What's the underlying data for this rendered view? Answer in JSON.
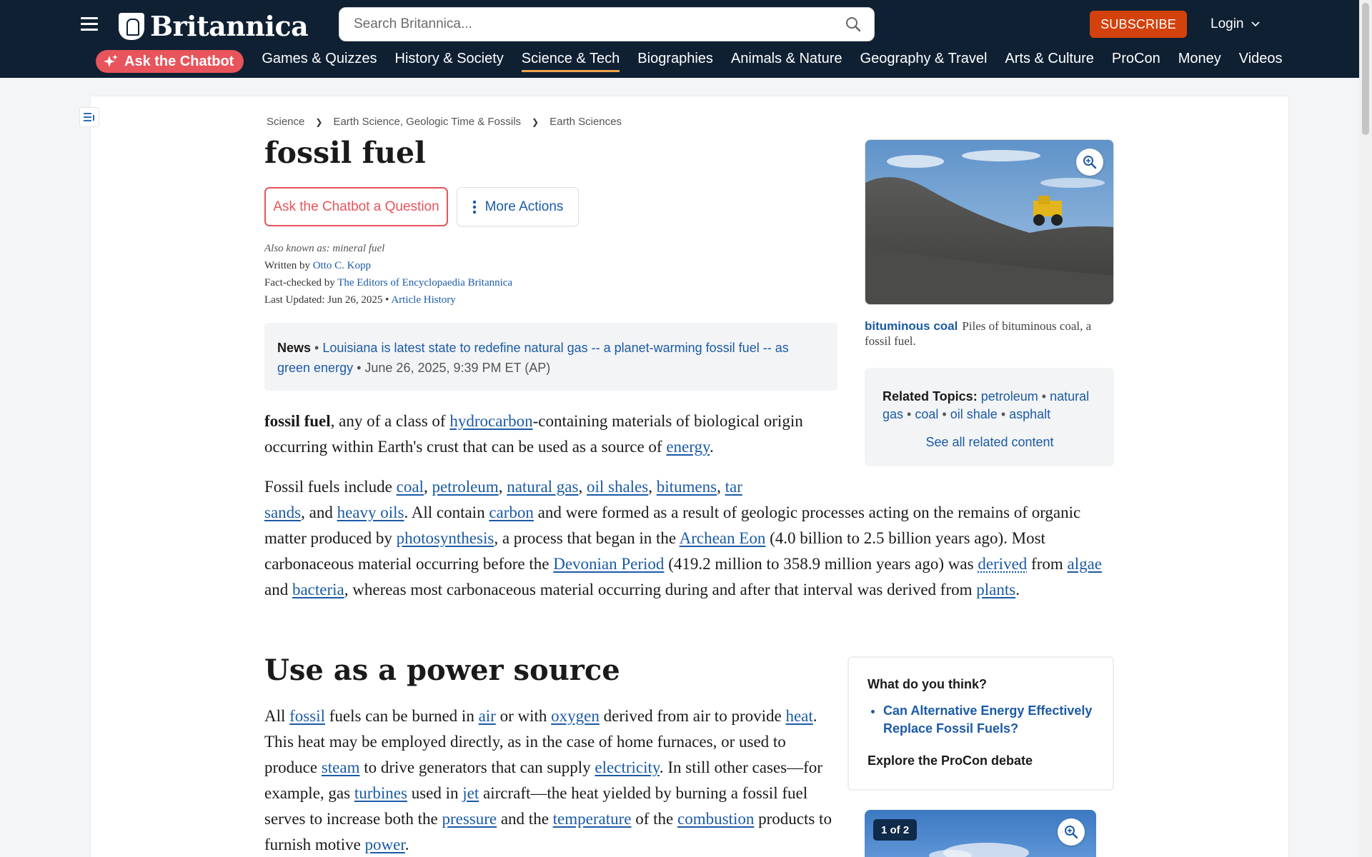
{
  "header": {
    "brand": "Britannica",
    "search_placeholder": "Search Britannica...",
    "subscribe_label": "SUBSCRIBE",
    "login_label": "Login"
  },
  "nav": {
    "chatbot_label": "Ask the Chatbot",
    "items": [
      "Games & Quizzes",
      "History & Society",
      "Science & Tech",
      "Biographies",
      "Animals & Nature",
      "Geography & Travel",
      "Arts & Culture",
      "ProCon",
      "Money",
      "Videos"
    ],
    "active": "Science & Tech"
  },
  "breadcrumb": [
    "Science",
    "Earth Science, Geologic Time & Fossils",
    "Earth Sciences"
  ],
  "article": {
    "title": "fossil fuel",
    "ask_chatbot_button": "Ask the Chatbot a Question",
    "more_actions_button": "More Actions",
    "also_known_as": "Also known as: mineral fuel",
    "written_by_label": "Written by",
    "author": "Otto C. Kopp",
    "fact_checked_label": "Fact-checked by",
    "fact_checker": "The Editors of Encyclopaedia Britannica",
    "last_updated_label": "Last Updated: Jun 26, 2025 •",
    "article_history": "Article History"
  },
  "news": {
    "label": "News",
    "bullet": "•",
    "headline": "Louisiana is latest state to redefine natural gas -- a planet-warming fossil fuel -- as green energy",
    "timestamp": "• June 26, 2025, 9:39 PM ET (AP)"
  },
  "paragraph1": {
    "term": "fossil fuel",
    "t1": ", any of a class of ",
    "l_hydrocarbon": "hydrocarbon",
    "t2": "-containing materials of biological origin occurring within Earth's crust that can be used as a source of ",
    "l_energy": "energy",
    "t3": "."
  },
  "paragraph2": {
    "t1": "Fossil fuels include ",
    "l_coal": "coal",
    "l_petroleum": "petroleum",
    "l_natural_gas": "natural gas",
    "l_oil_shales": "oil shales",
    "l_bitumens": "bitumens",
    "l_tar": "tar",
    "l_sands": "sands",
    "t2": ", and ",
    "l_heavy_oils": "heavy oils",
    "t3": ". All contain ",
    "l_carbon": "carbon",
    "t4": " and were formed as a result of geologic processes acting on the remains of organic matter produced by ",
    "l_photosynthesis": "photosynthesis",
    "t5": ", a process that began in the ",
    "l_archean": "Archean Eon",
    "t6": " (4.0 billion to 2.5 billion years ago). Most carbonaceous material occurring before the ",
    "l_devonian": "Devonian Period",
    "t7": " (419.2 million to 358.9 million years ago) was ",
    "l_derived": "derived",
    "t8": " from ",
    "l_algae": "algae",
    "t9": " and ",
    "l_bacteria": "bacteria",
    "t10": ", whereas most carbonaceous material occurring during and after that interval was derived from ",
    "l_plants": "plants",
    "t11": "."
  },
  "section": {
    "heading": "Use as a power source",
    "t1": "All ",
    "l_fossil": "fossil",
    "t2": " fuels can be burned in ",
    "l_air": "air",
    "t3": " or with ",
    "l_oxygen": "oxygen",
    "t4": " derived from air to provide ",
    "l_heat": "heat",
    "t5": ". This heat may be employed directly, as in the case of home furnaces, or used to produce ",
    "l_steam": "steam",
    "t6": " to drive generators that can supply ",
    "l_electricity": "electricity",
    "t7": ". In still other cases—for example, gas ",
    "l_turbines": "turbines",
    "t8": " used in ",
    "l_jet": "jet",
    "t9": " aircraft—the heat yielded by burning a fossil fuel serves to increase both the ",
    "l_pressure": "pressure",
    "t10": " and the ",
    "l_temperature": "temperature",
    "t11": " of the ",
    "l_combustion": "combustion",
    "t12": " products to furnish motive ",
    "l_power": "power",
    "t13": "."
  },
  "hero_image": {
    "caption_title": "bituminous coal",
    "caption_text": "Piles of bituminous coal, a fossil fuel."
  },
  "related": {
    "label": "Related Topics:",
    "topics": [
      "petroleum",
      "natural gas",
      "coal",
      "oil shale",
      "asphalt"
    ],
    "separator": "•",
    "see_all": "See all related content"
  },
  "procon": {
    "question": "What do you think?",
    "debate": "Can Alternative Energy Effectively Replace Fossil Fuels?",
    "explore": "Explore the ProCon debate"
  },
  "gallery": {
    "count": "1 of 2"
  },
  "colors": {
    "header_bg": "#0f2033",
    "subscribe": "#d3420c",
    "chatbot": "#e8545b",
    "link": "#1b5aa6",
    "nav_active_underline": "#f0a24b"
  }
}
